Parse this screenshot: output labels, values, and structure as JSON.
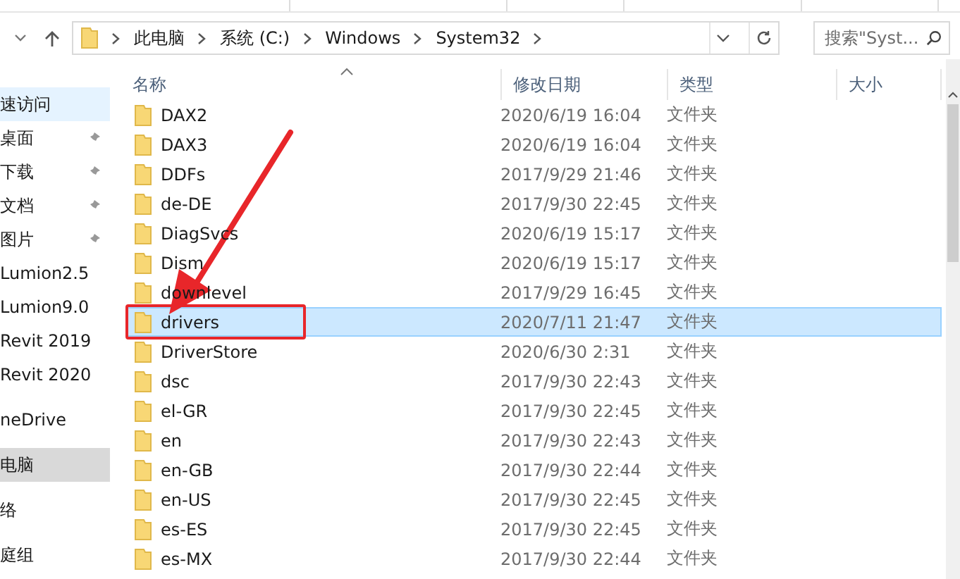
{
  "address_bar": {
    "path": [
      "此电脑",
      "系统 (C:)",
      "Windows",
      "System32"
    ]
  },
  "search": {
    "placeholder": "搜索\"Syst..."
  },
  "navigation": {
    "groups": [
      {
        "items": [
          {
            "label": "速访问",
            "pinned": false,
            "selected": false,
            "hover": true
          },
          {
            "label": "桌面",
            "pinned": true,
            "selected": false,
            "hover": false
          },
          {
            "label": "下载",
            "pinned": true,
            "selected": false,
            "hover": false
          },
          {
            "label": "文档",
            "pinned": true,
            "selected": false,
            "hover": false
          },
          {
            "label": "图片",
            "pinned": true,
            "selected": false,
            "hover": false
          },
          {
            "label": "Lumion2.5",
            "pinned": false,
            "selected": false,
            "hover": false
          },
          {
            "label": "Lumion9.0",
            "pinned": false,
            "selected": false,
            "hover": false
          },
          {
            "label": "Revit 2019",
            "pinned": false,
            "selected": false,
            "hover": false
          },
          {
            "label": "Revit 2020",
            "pinned": false,
            "selected": false,
            "hover": false
          }
        ]
      },
      {
        "items": [
          {
            "label": "neDrive",
            "pinned": false,
            "selected": false,
            "hover": false
          }
        ]
      },
      {
        "items": [
          {
            "label": "电脑",
            "pinned": false,
            "selected": true,
            "hover": false
          }
        ]
      },
      {
        "items": [
          {
            "label": "络",
            "pinned": false,
            "selected": false,
            "hover": false
          }
        ]
      },
      {
        "items": [
          {
            "label": "庭组",
            "pinned": false,
            "selected": false,
            "hover": false
          }
        ]
      }
    ]
  },
  "file_list": {
    "columns": [
      "名称",
      "修改日期",
      "类型",
      "大小"
    ],
    "rows": [
      {
        "name": "DAX2",
        "modified": "2020/6/19 16:04",
        "type": "文件夹",
        "selected": false,
        "annotated": false
      },
      {
        "name": "DAX3",
        "modified": "2020/6/19 16:04",
        "type": "文件夹",
        "selected": false,
        "annotated": false
      },
      {
        "name": "DDFs",
        "modified": "2017/9/29 21:46",
        "type": "文件夹",
        "selected": false,
        "annotated": false
      },
      {
        "name": "de-DE",
        "modified": "2017/9/30 22:45",
        "type": "文件夹",
        "selected": false,
        "annotated": false
      },
      {
        "name": "DiagSvcs",
        "modified": "2020/6/19 15:17",
        "type": "文件夹",
        "selected": false,
        "annotated": false
      },
      {
        "name": "Dism",
        "modified": "2020/6/19 15:17",
        "type": "文件夹",
        "selected": false,
        "annotated": false
      },
      {
        "name": "downlevel",
        "modified": "2017/9/29 16:45",
        "type": "文件夹",
        "selected": false,
        "annotated": false
      },
      {
        "name": "drivers",
        "modified": "2020/7/11 21:47",
        "type": "文件夹",
        "selected": true,
        "annotated": true
      },
      {
        "name": "DriverStore",
        "modified": "2020/6/30 2:31",
        "type": "文件夹",
        "selected": false,
        "annotated": false
      },
      {
        "name": "dsc",
        "modified": "2017/9/30 22:43",
        "type": "文件夹",
        "selected": false,
        "annotated": false
      },
      {
        "name": "el-GR",
        "modified": "2017/9/30 22:45",
        "type": "文件夹",
        "selected": false,
        "annotated": false
      },
      {
        "name": "en",
        "modified": "2017/9/30 22:43",
        "type": "文件夹",
        "selected": false,
        "annotated": false
      },
      {
        "name": "en-GB",
        "modified": "2017/9/30 22:44",
        "type": "文件夹",
        "selected": false,
        "annotated": false
      },
      {
        "name": "en-US",
        "modified": "2017/9/30 22:45",
        "type": "文件夹",
        "selected": false,
        "annotated": false
      },
      {
        "name": "es-ES",
        "modified": "2017/9/30 22:45",
        "type": "文件夹",
        "selected": false,
        "annotated": false
      },
      {
        "name": "es-MX",
        "modified": "2017/9/30 22:44",
        "type": "文件夹",
        "selected": false,
        "annotated": false
      }
    ]
  }
}
